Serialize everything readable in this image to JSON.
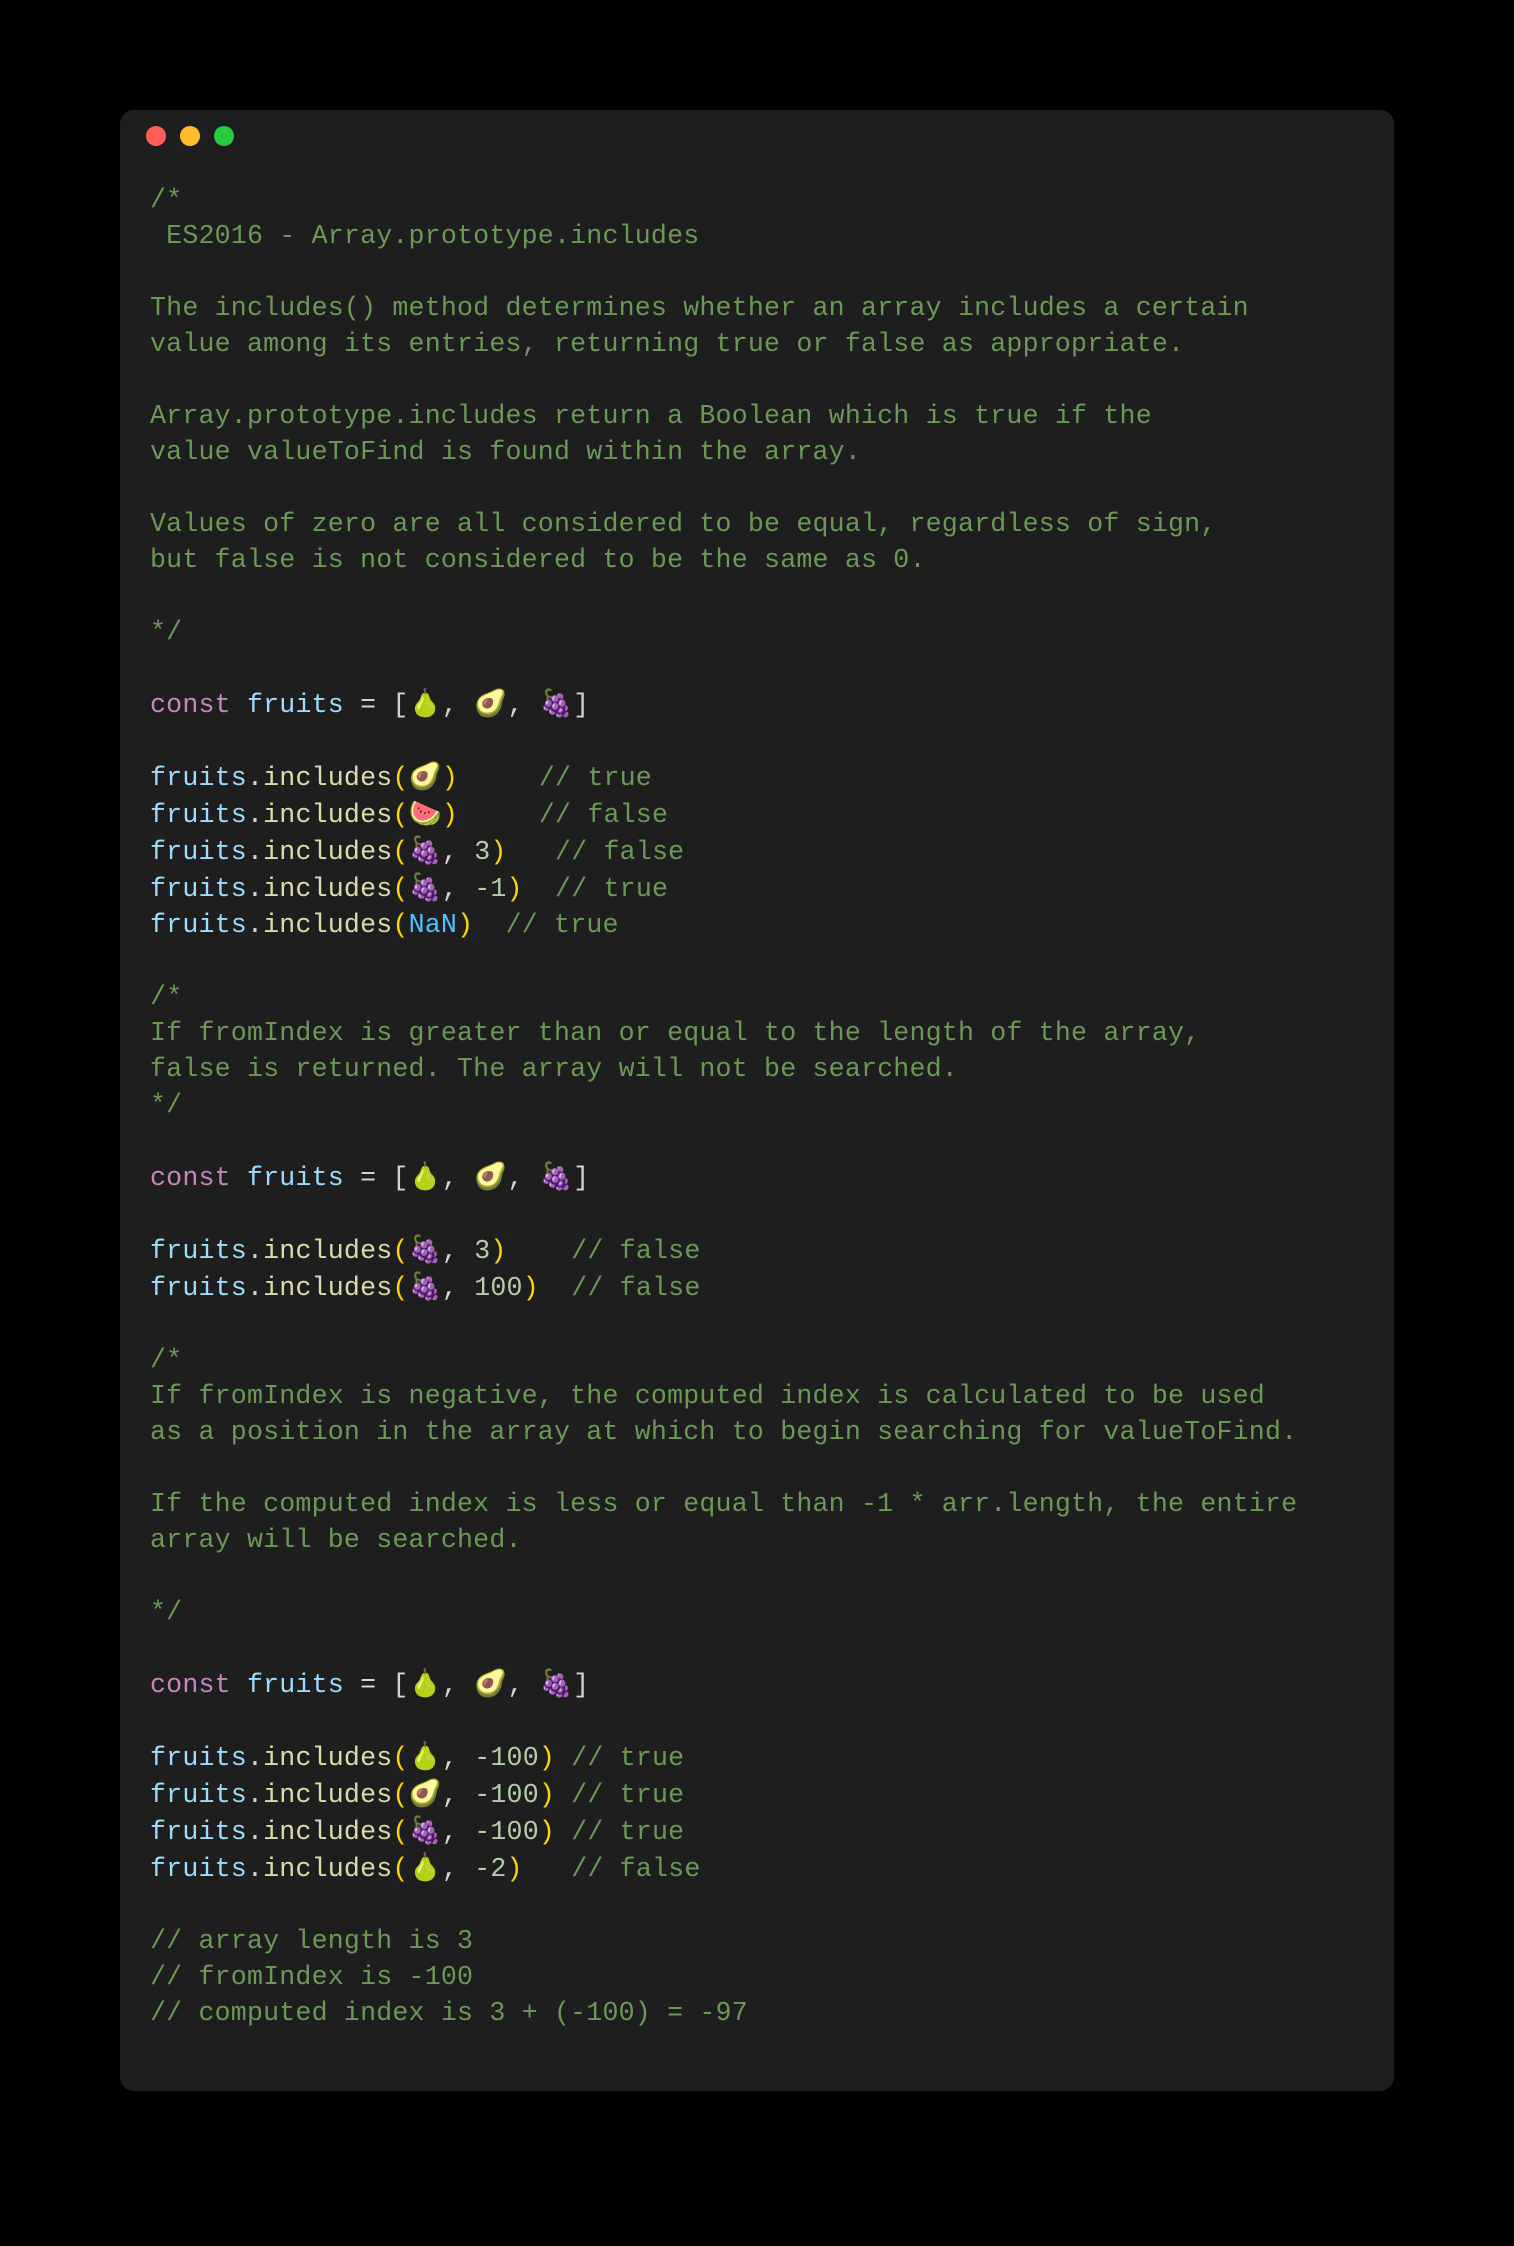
{
  "traffic": {
    "red": "#ff5f56",
    "yellow": "#ffbd2e",
    "green": "#27c93f"
  },
  "comment1": "/*\n ES2016 - Array.prototype.includes\n\nThe includes() method determines whether an array includes a certain\nvalue among its entries, returning true or false as appropriate.\n\nArray.prototype.includes return a Boolean which is true if the\nvalue valueToFind is found within the array.\n\nValues of zero are all considered to be equal, regardless of sign,\nbut false is not considered to be the same as 0.\n\n*/",
  "kw_const": "const",
  "id_fruits": "fruits",
  "eq": " = ",
  "lbrack": "[",
  "rbrack": "]",
  "comma": ", ",
  "emoji_pear": "🍐",
  "emoji_avocado": "🥑",
  "emoji_grapes": "🍇",
  "emoji_watermelon": "🍉",
  "dot": ".",
  "fn_includes": "includes",
  "lparen": "(",
  "rparen": ")",
  "num_3": "3",
  "num_neg1": "-1",
  "num_100": "100",
  "num_neg100": "-100",
  "num_neg2": "-2",
  "nan": "NaN",
  "cm_true": "// true",
  "cm_false": "// false",
  "comment2": "/*\nIf fromIndex is greater than or equal to the length of the array,\nfalse is returned. The array will not be searched.\n*/",
  "comment3": "/*\nIf fromIndex is negative, the computed index is calculated to be used\nas a position in the array at which to begin searching for valueToFind.\n\nIf the computed index is less or equal than -1 * arr.length, the entire\narray will be searched.\n\n*/",
  "tail1": "// array length is 3",
  "tail2": "// fromIndex is -100",
  "tail3": "// computed index is 3 + (-100) = -97"
}
